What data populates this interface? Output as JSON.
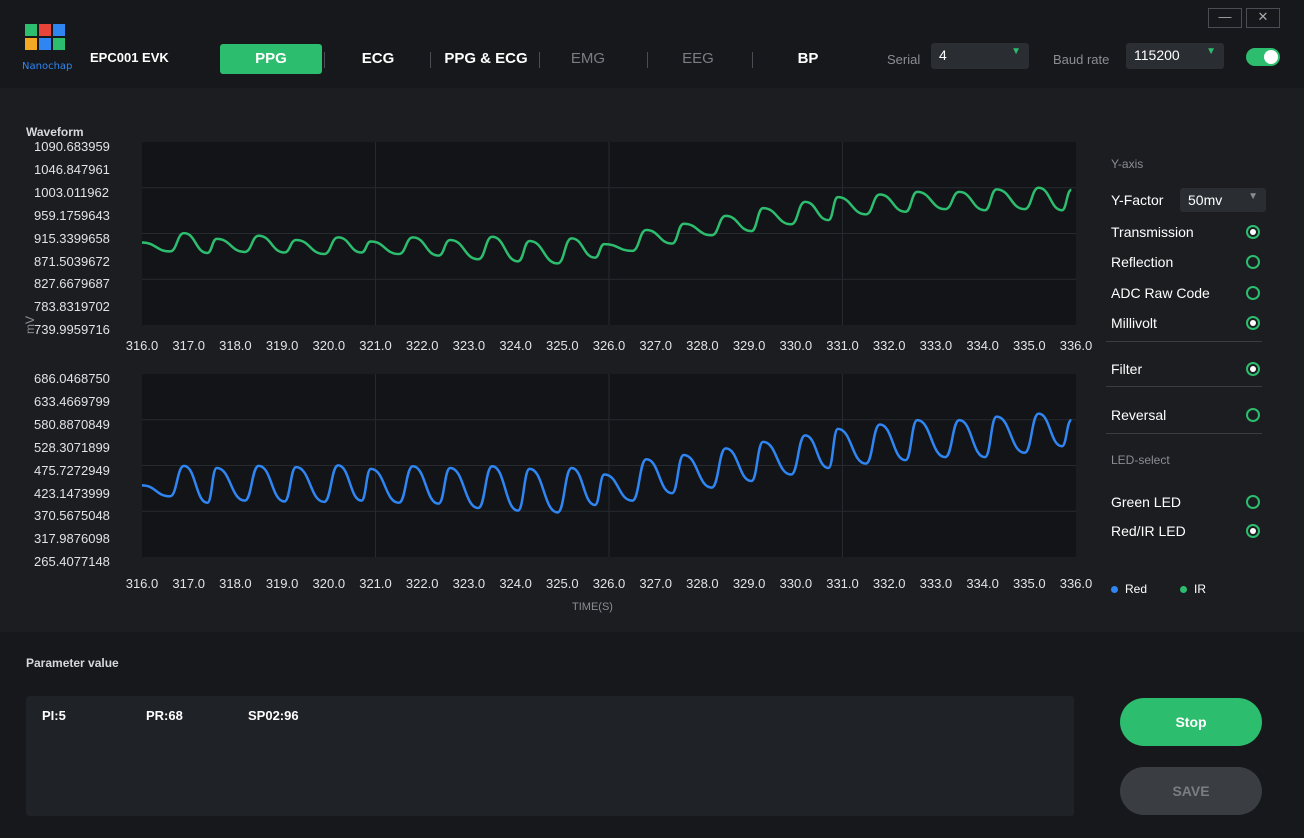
{
  "app": {
    "logo_text": "Nanochap",
    "title": "EPC001 EVK"
  },
  "window_controls": {
    "minimize": "—",
    "close": "✕"
  },
  "nav": {
    "tabs": [
      {
        "label": "PPG",
        "state": "active"
      },
      {
        "label": "ECG",
        "state": "enabled"
      },
      {
        "label": "PPG & ECG",
        "state": "enabled"
      },
      {
        "label": "EMG",
        "state": "disabled"
      },
      {
        "label": "EEG",
        "state": "disabled"
      },
      {
        "label": "BP",
        "state": "enabled"
      }
    ]
  },
  "serial": {
    "label": "Serial",
    "value": "4"
  },
  "baud": {
    "label": "Baud rate",
    "value": "115200"
  },
  "connection_toggle": {
    "on": true
  },
  "waveform": {
    "title": "Waveform",
    "unit": "mV",
    "time_label": "TIME(S)",
    "top_yticks": [
      "1090.683959",
      "1046.847961",
      "1003.011962",
      "959.1759643",
      "915.3399658",
      "871.5039672",
      "827.6679687",
      "783.8319702",
      "739.9959716"
    ],
    "bottom_yticks": [
      "686.0468750",
      "633.4669799",
      "580.8870849",
      "528.3071899",
      "475.7272949",
      "423.1473999",
      "370.5675048",
      "317.9876098",
      "265.4077148"
    ],
    "xticks": [
      "316.0",
      "317.0",
      "318.0",
      "319.0",
      "320.0",
      "321.0",
      "322.0",
      "323.0",
      "324.0",
      "325.0",
      "326.0",
      "327.0",
      "328.0",
      "329.0",
      "330.0",
      "331.0",
      "332.0",
      "333.0",
      "334.0",
      "335.0",
      "336.0"
    ]
  },
  "chart_data": [
    {
      "type": "line",
      "name": "IR",
      "color": "#2dbd6e",
      "ylim": [
        739.9959716,
        1090.683959
      ],
      "xlim": [
        316.0,
        336.0
      ],
      "x": [
        316.0,
        316.9,
        317.6,
        318.5,
        319.3,
        320.2,
        320.9,
        321.8,
        322.6,
        323.5,
        324.3,
        325.2,
        325.9,
        326.8,
        327.6,
        328.5,
        329.3,
        330.2,
        330.9,
        331.8,
        332.6,
        333.5,
        334.3,
        335.2,
        335.9
      ],
      "values": [
        898,
        916,
        905,
        911,
        903,
        908,
        900,
        908,
        903,
        909,
        901,
        906,
        895,
        922,
        934,
        949,
        964,
        976,
        985,
        990,
        995,
        995,
        1000,
        1003,
        999
      ],
      "troughs": [
        881,
        878,
        880,
        879,
        876,
        879,
        876,
        873,
        866,
        862,
        858,
        869,
        882,
        896,
        912,
        920,
        933,
        941,
        952,
        957,
        962,
        960,
        962,
        960
      ]
    },
    {
      "type": "line",
      "name": "Red",
      "color": "#2f86f3",
      "ylim": [
        265.4077148,
        686.046875
      ],
      "xlim": [
        316.0,
        336.0
      ],
      "x": [
        316.0,
        316.9,
        317.6,
        318.5,
        319.3,
        320.2,
        320.9,
        321.8,
        322.6,
        323.5,
        324.3,
        325.2,
        325.9,
        326.8,
        327.6,
        328.5,
        329.3,
        330.2,
        330.9,
        331.8,
        332.6,
        333.5,
        334.3,
        335.2,
        335.9
      ],
      "values": [
        430,
        475,
        470,
        475,
        472,
        476,
        468,
        474,
        470,
        474,
        468,
        470,
        455,
        490,
        500,
        515,
        530,
        545,
        560,
        570,
        580,
        580,
        588,
        595,
        580
      ],
      "troughs": [
        405,
        390,
        395,
        393,
        392,
        395,
        390,
        388,
        378,
        372,
        368,
        385,
        395,
        412,
        425,
        440,
        455,
        470,
        480,
        488,
        495,
        495,
        505,
        520
      ]
    }
  ],
  "right_panel": {
    "yaxis_heading": "Y-axis",
    "y_factor": {
      "label": "Y-Factor",
      "value": "50mv"
    },
    "options": [
      {
        "label": "Transmission",
        "checked": true
      },
      {
        "label": "Reflection",
        "checked": false
      },
      {
        "label": "ADC Raw Code",
        "checked": false
      },
      {
        "label": "Millivolt",
        "checked": true
      },
      {
        "label": "Filter",
        "checked": true
      },
      {
        "label": "Reversal",
        "checked": false
      }
    ],
    "led_heading": "LED-select",
    "led_options": [
      {
        "label": "Green LED",
        "checked": false
      },
      {
        "label": "Red/IR LED",
        "checked": true
      }
    ],
    "legend": [
      {
        "label": "Red",
        "color": "#2f86f3"
      },
      {
        "label": "IR",
        "color": "#2dbd6e"
      }
    ]
  },
  "parameters": {
    "title": "Parameter value",
    "pi": "PI:5",
    "pr": "PR:68",
    "spo2": "SP02:96"
  },
  "buttons": {
    "stop": "Stop",
    "save": "SAVE"
  }
}
